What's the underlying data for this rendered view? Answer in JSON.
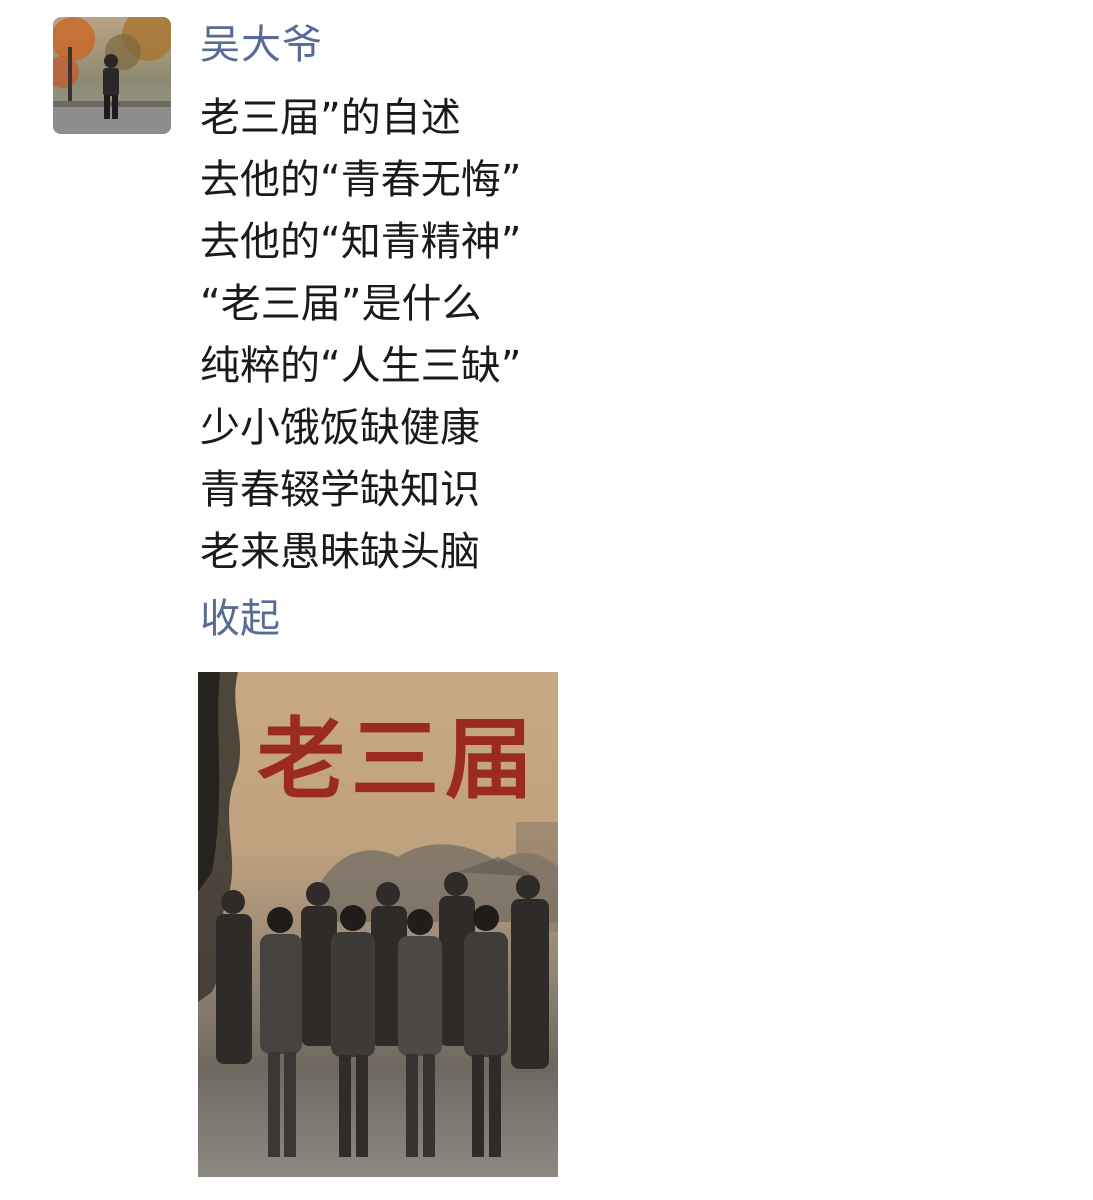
{
  "post": {
    "author": "吴大爷",
    "lines": [
      "老三届”的自述",
      "去他的“青春无悔”",
      "去他的“知青精神”",
      "“老三届”是什么",
      "纯粹的“人生三缺”",
      "少小饿饭缺健康",
      "青春辍学缺知识",
      "老来愚昧缺头脑"
    ],
    "collapse_label": "收起",
    "image": {
      "title_text": "老三届",
      "title_color": "#9a2a22"
    }
  },
  "colors": {
    "author_link": "#576b95",
    "body_text": "#1a1a1a"
  }
}
